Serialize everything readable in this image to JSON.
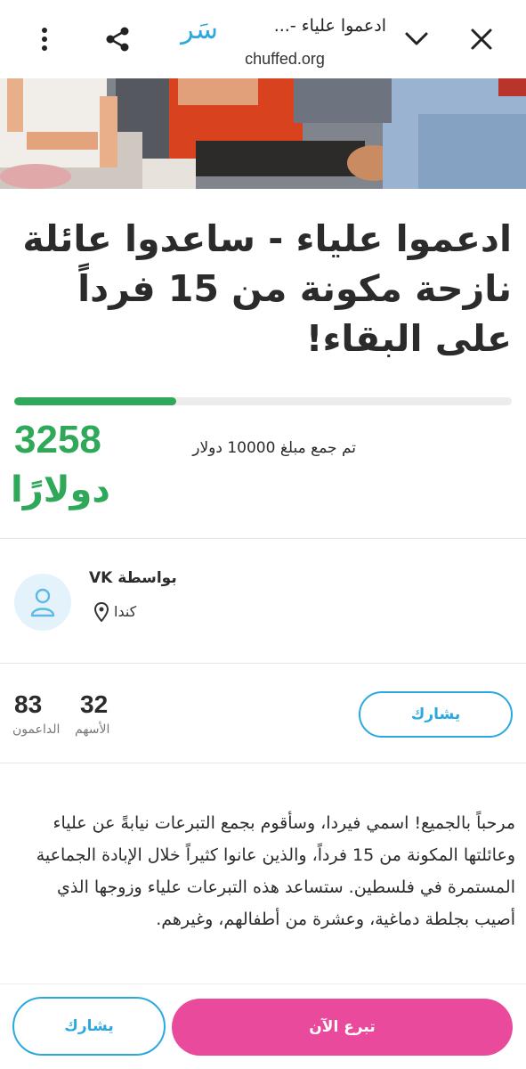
{
  "browser": {
    "title": "ادعموا علياء -...",
    "url": "chuffed.org",
    "logo_text": "سَر"
  },
  "campaign": {
    "title": "ادعموا علياء - ساعدوا عائلة نازحة مكونة من 15 فرداً على البقاء!",
    "raised_amount": "3258",
    "raised_currency": "دولارًا",
    "goal_text": "تم جمع مبلغ 10000 دولار",
    "progress_fraction": 0.326
  },
  "organizer": {
    "by_label": "بواسطة VK",
    "location": "كندا"
  },
  "stats": {
    "supporters_count": "83",
    "supporters_label": "الداعمون",
    "shares_count": "32",
    "shares_label": "الأسهم",
    "share_button": "يشارك"
  },
  "description": "مرحباً بالجميع! اسمي فيردا، وسأقوم بجمع التبرعات نيابةً عن علياء وعائلتها المكونة من 15 فرداً، والذين عانوا كثيراً خلال الإبادة الجماعية المستمرة في فلسطين. ستساعد هذه التبرعات علياء وزوجها الذي أصيب بجلطة دماغية، وعشرة من أطفالهم، وغيرهم.",
  "actions": {
    "share_label": "يشارك",
    "donate_label": "تبرع الآن"
  },
  "colors": {
    "accent_blue": "#2ba8e0",
    "progress_green": "#2fa85a",
    "donate_pink": "#e94a9b"
  },
  "icons": [
    "close-icon",
    "chevron-down-icon",
    "share-icon",
    "more-vertical-icon",
    "user-icon",
    "location-pin-icon"
  ]
}
